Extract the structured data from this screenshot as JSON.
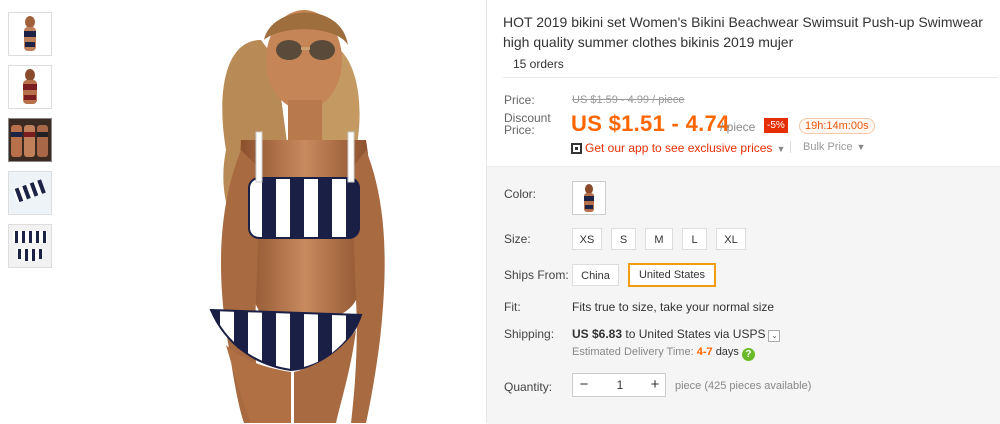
{
  "product": {
    "title": "HOT 2019 bikini set Women's Bikini Beachwear Swimsuit Push-up Swimwear high quality summer clothes bikinis 2019 mujer",
    "orders": "15 orders"
  },
  "price": {
    "label": "Price:",
    "original": "US $1.59 - 4.99 / piece",
    "discount_label": "Discount Price:",
    "discount": "US $1.51 - 4.74",
    "per_piece": "/ piece",
    "percent_off": "-5%",
    "timer": "19h:14m:00s",
    "app_promo": "Get our app to see exclusive prices",
    "bulk": "Bulk Price"
  },
  "options": {
    "color_label": "Color:",
    "size_label": "Size:",
    "sizes": [
      "XS",
      "S",
      "M",
      "L",
      "XL"
    ],
    "ships_from_label": "Ships From:",
    "ships_from": [
      "China",
      "United States"
    ],
    "ships_from_selected": "United States",
    "fit_label": "Fit:",
    "fit_text": "Fits true to size, take your normal size",
    "shipping_label": "Shipping:",
    "shipping_cost": "US $6.83",
    "shipping_to": "to United States via USPS",
    "delivery_label": "Estimated Delivery Time:",
    "delivery_days": "4-7",
    "delivery_unit": "days",
    "quantity_label": "Quantity:",
    "quantity": "1",
    "quantity_note": "piece (425 pieces available)"
  },
  "colors": {
    "accent": "#ff6600",
    "sale_badge": "#e62e04",
    "selected_border": "#f29c11"
  }
}
